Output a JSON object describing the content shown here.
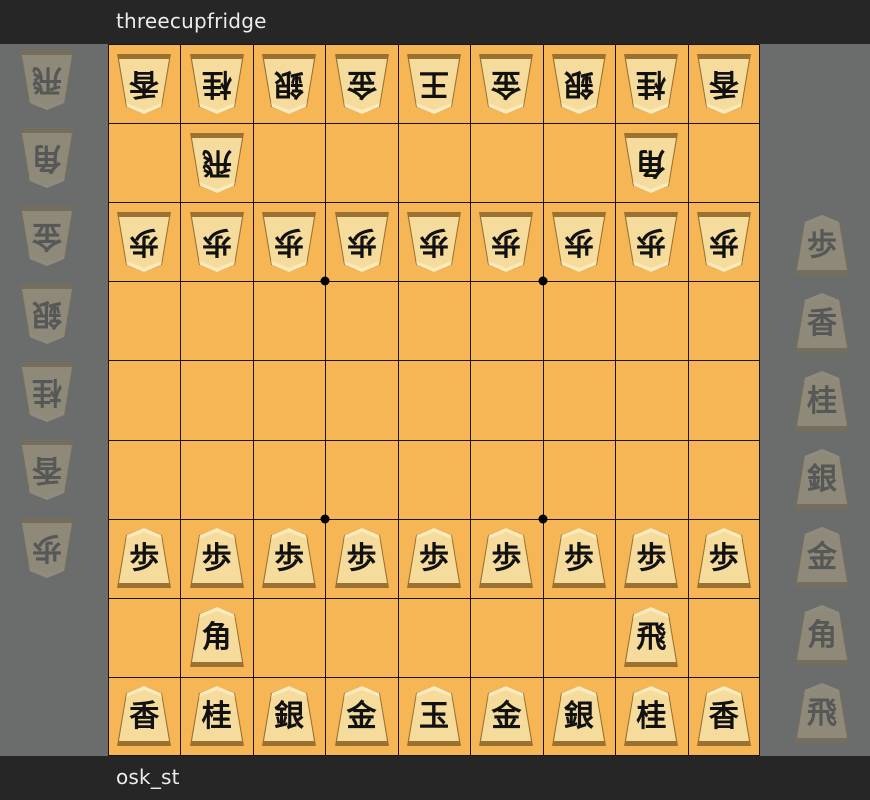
{
  "players": {
    "top_name": "threecupfridge",
    "bottom_name": "osk_st"
  },
  "board": {
    "files": 9,
    "ranks": 9,
    "star_points": [
      [
        3,
        3
      ],
      [
        6,
        3
      ],
      [
        3,
        6
      ],
      [
        6,
        6
      ]
    ],
    "pieces": [
      {
        "row": 0,
        "col": 0,
        "kanji": "香",
        "side": "gote"
      },
      {
        "row": 0,
        "col": 1,
        "kanji": "桂",
        "side": "gote"
      },
      {
        "row": 0,
        "col": 2,
        "kanji": "銀",
        "side": "gote"
      },
      {
        "row": 0,
        "col": 3,
        "kanji": "金",
        "side": "gote"
      },
      {
        "row": 0,
        "col": 4,
        "kanji": "王",
        "side": "gote"
      },
      {
        "row": 0,
        "col": 5,
        "kanji": "金",
        "side": "gote"
      },
      {
        "row": 0,
        "col": 6,
        "kanji": "銀",
        "side": "gote"
      },
      {
        "row": 0,
        "col": 7,
        "kanji": "桂",
        "side": "gote"
      },
      {
        "row": 0,
        "col": 8,
        "kanji": "香",
        "side": "gote"
      },
      {
        "row": 1,
        "col": 1,
        "kanji": "飛",
        "side": "gote"
      },
      {
        "row": 1,
        "col": 7,
        "kanji": "角",
        "side": "gote"
      },
      {
        "row": 2,
        "col": 0,
        "kanji": "歩",
        "side": "gote"
      },
      {
        "row": 2,
        "col": 1,
        "kanji": "歩",
        "side": "gote"
      },
      {
        "row": 2,
        "col": 2,
        "kanji": "歩",
        "side": "gote"
      },
      {
        "row": 2,
        "col": 3,
        "kanji": "歩",
        "side": "gote"
      },
      {
        "row": 2,
        "col": 4,
        "kanji": "歩",
        "side": "gote"
      },
      {
        "row": 2,
        "col": 5,
        "kanji": "歩",
        "side": "gote"
      },
      {
        "row": 2,
        "col": 6,
        "kanji": "歩",
        "side": "gote"
      },
      {
        "row": 2,
        "col": 7,
        "kanji": "歩",
        "side": "gote"
      },
      {
        "row": 2,
        "col": 8,
        "kanji": "歩",
        "side": "gote"
      },
      {
        "row": 6,
        "col": 0,
        "kanji": "歩",
        "side": "sente"
      },
      {
        "row": 6,
        "col": 1,
        "kanji": "歩",
        "side": "sente"
      },
      {
        "row": 6,
        "col": 2,
        "kanji": "歩",
        "side": "sente"
      },
      {
        "row": 6,
        "col": 3,
        "kanji": "歩",
        "side": "sente"
      },
      {
        "row": 6,
        "col": 4,
        "kanji": "歩",
        "side": "sente"
      },
      {
        "row": 6,
        "col": 5,
        "kanji": "歩",
        "side": "sente"
      },
      {
        "row": 6,
        "col": 6,
        "kanji": "歩",
        "side": "sente"
      },
      {
        "row": 6,
        "col": 7,
        "kanji": "歩",
        "side": "sente"
      },
      {
        "row": 6,
        "col": 8,
        "kanji": "歩",
        "side": "sente"
      },
      {
        "row": 7,
        "col": 1,
        "kanji": "角",
        "side": "sente"
      },
      {
        "row": 7,
        "col": 7,
        "kanji": "飛",
        "side": "sente"
      },
      {
        "row": 8,
        "col": 0,
        "kanji": "香",
        "side": "sente"
      },
      {
        "row": 8,
        "col": 1,
        "kanji": "桂",
        "side": "sente"
      },
      {
        "row": 8,
        "col": 2,
        "kanji": "銀",
        "side": "sente"
      },
      {
        "row": 8,
        "col": 3,
        "kanji": "金",
        "side": "sente"
      },
      {
        "row": 8,
        "col": 4,
        "kanji": "玉",
        "side": "sente"
      },
      {
        "row": 8,
        "col": 5,
        "kanji": "金",
        "side": "sente"
      },
      {
        "row": 8,
        "col": 6,
        "kanji": "銀",
        "side": "sente"
      },
      {
        "row": 8,
        "col": 7,
        "kanji": "桂",
        "side": "sente"
      },
      {
        "row": 8,
        "col": 8,
        "kanji": "香",
        "side": "sente"
      }
    ]
  },
  "hands": {
    "gote": [
      "飛",
      "角",
      "金",
      "銀",
      "桂",
      "香",
      "歩"
    ],
    "sente": [
      "歩",
      "香",
      "桂",
      "銀",
      "金",
      "角",
      "飛"
    ]
  },
  "colors": {
    "board": "#f7b656",
    "grid": "#1b1408",
    "piece_face": "#f5dc9c",
    "piece_edge": "#9a7130",
    "background": "#6b6d6c",
    "namebar": "#262626"
  }
}
